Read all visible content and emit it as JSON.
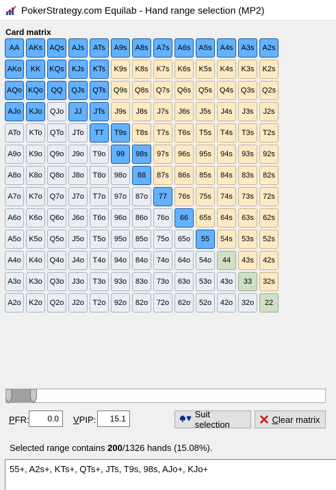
{
  "window": {
    "title": "PokerStrategy.com Equilab - Hand range selection (MP2)",
    "icon": "equilab-chart-icon"
  },
  "matrix": {
    "label": "Card matrix",
    "rows": [
      [
        "AA",
        "AKs",
        "AQs",
        "AJs",
        "ATs",
        "A9s",
        "A8s",
        "A7s",
        "A6s",
        "A5s",
        "A4s",
        "A3s",
        "A2s"
      ],
      [
        "AKo",
        "KK",
        "KQs",
        "KJs",
        "KTs",
        "K9s",
        "K8s",
        "K7s",
        "K6s",
        "K5s",
        "K4s",
        "K3s",
        "K2s"
      ],
      [
        "AQo",
        "KQo",
        "QQ",
        "QJs",
        "QTs",
        "Q9s",
        "Q8s",
        "Q7s",
        "Q6s",
        "Q5s",
        "Q4s",
        "Q3s",
        "Q2s"
      ],
      [
        "AJo",
        "KJo",
        "QJo",
        "JJ",
        "JTs",
        "J9s",
        "J8s",
        "J7s",
        "J6s",
        "J5s",
        "J4s",
        "J3s",
        "J2s"
      ],
      [
        "ATo",
        "KTo",
        "QTo",
        "JTo",
        "TT",
        "T9s",
        "T8s",
        "T7s",
        "T6s",
        "T5s",
        "T4s",
        "T3s",
        "T2s"
      ],
      [
        "A9o",
        "K9o",
        "Q9o",
        "J9o",
        "T9o",
        "99",
        "98s",
        "97s",
        "96s",
        "95s",
        "94s",
        "93s",
        "92s"
      ],
      [
        "A8o",
        "K8o",
        "Q8o",
        "J8o",
        "T8o",
        "98o",
        "88",
        "87s",
        "86s",
        "85s",
        "84s",
        "83s",
        "82s"
      ],
      [
        "A7o",
        "K7o",
        "Q7o",
        "J7o",
        "T7o",
        "97o",
        "87o",
        "77",
        "76s",
        "75s",
        "74s",
        "73s",
        "72s"
      ],
      [
        "A6o",
        "K6o",
        "Q6o",
        "J6o",
        "T6o",
        "96o",
        "86o",
        "76o",
        "66",
        "65s",
        "64s",
        "63s",
        "62s"
      ],
      [
        "A5o",
        "K5o",
        "Q5o",
        "J5o",
        "T5o",
        "95o",
        "85o",
        "75o",
        "65o",
        "55",
        "54s",
        "53s",
        "52s"
      ],
      [
        "A4o",
        "K4o",
        "Q4o",
        "J4o",
        "T4o",
        "94o",
        "84o",
        "74o",
        "64o",
        "54o",
        "44",
        "43s",
        "42s"
      ],
      [
        "A3o",
        "K3o",
        "Q3o",
        "J3o",
        "T3o",
        "93o",
        "83o",
        "73o",
        "63o",
        "53o",
        "43o",
        "33",
        "32s"
      ],
      [
        "A2o",
        "K2o",
        "Q2o",
        "J2o",
        "T2o",
        "92o",
        "82o",
        "72o",
        "62o",
        "52o",
        "42o",
        "32o",
        "22"
      ]
    ],
    "selected": [
      "AA",
      "KK",
      "QQ",
      "JJ",
      "TT",
      "99",
      "88",
      "77",
      "66",
      "55",
      "AKs",
      "AQs",
      "AJs",
      "ATs",
      "A9s",
      "A8s",
      "A7s",
      "A6s",
      "A5s",
      "A4s",
      "A3s",
      "A2s",
      "KQs",
      "KJs",
      "KTs",
      "QJs",
      "QTs",
      "JTs",
      "T9s",
      "98s",
      "AKo",
      "AQo",
      "AJo",
      "KQo",
      "KJo"
    ],
    "colors": {
      "selected": "#63b1ff",
      "suited": "#fde9c3",
      "offsuit": "#e8eef4",
      "pair": "#dbe8f5",
      "small_pair": "#cfe0c6"
    }
  },
  "slider": {
    "value_percent": 15.1
  },
  "controls": {
    "pfr_label": "PFR:",
    "pfr_value": "0.0",
    "vpip_label": "VPIP:",
    "vpip_value": "15.1",
    "suit_selection_label": "Suit selection",
    "suit_selection_icon": "suits-icon",
    "clear_matrix_label": "Clear matrix",
    "clear_matrix_icon": "red-x-icon"
  },
  "status": {
    "prefix": "Selected range contains ",
    "selected_count": "200",
    "suffix": "/1326 hands (15.08%)."
  },
  "range_text": "55+, A2s+, KTs+, QTs+, JTs, T9s, 98s, AJo+, KJo+"
}
